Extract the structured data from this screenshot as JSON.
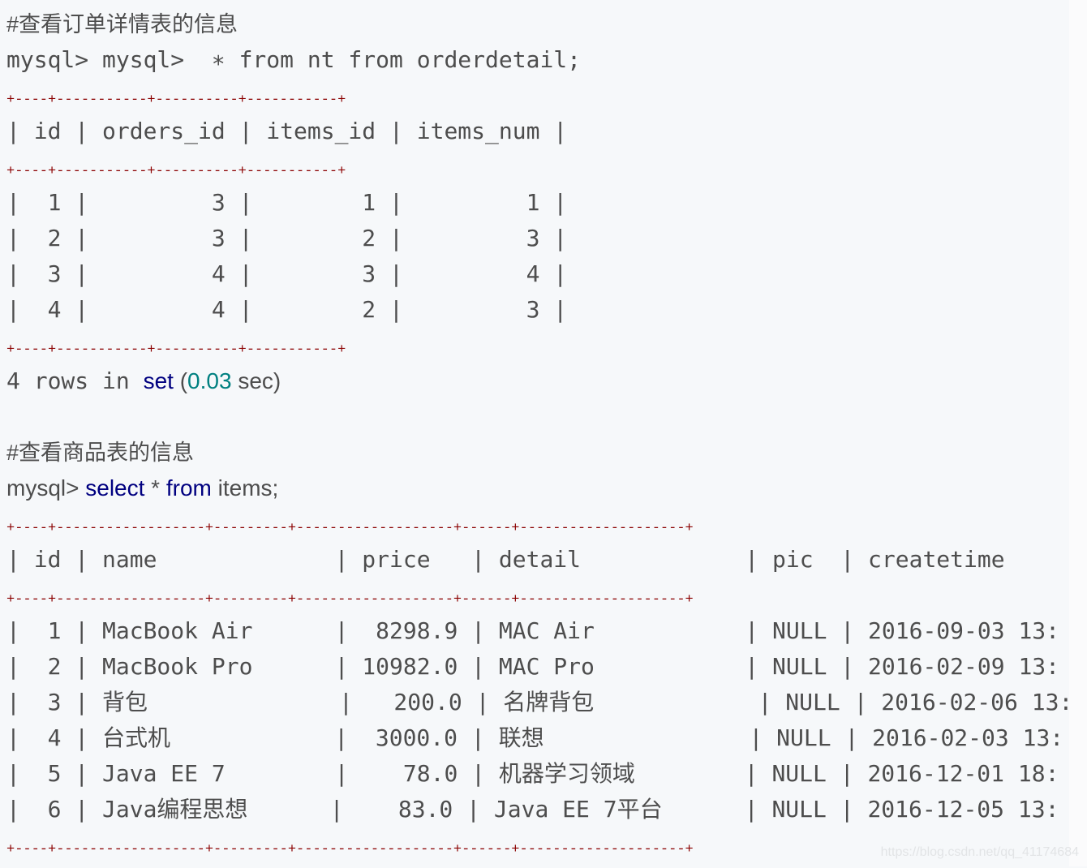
{
  "colors": {
    "background": "#f6f8fa",
    "text": "#4d4d4d",
    "keyword": "#000080",
    "number": "#008080",
    "table_border": "#8b0000"
  },
  "lines": [
    [
      {
        "t": "#查看订单详情表的信息",
        "c": "sans"
      }
    ],
    [
      {
        "t": "mysql> mysql>  ∗ from nt from orderdetail;",
        "c": ""
      }
    ],
    [
      {
        "t": "+----+-----------+----------+-----------+",
        "c": "border"
      }
    ],
    [
      {
        "t": "| id | orders_id | items_id | items_num |",
        "c": ""
      }
    ],
    [
      {
        "t": "+----+-----------+----------+-----------+",
        "c": "border"
      }
    ],
    [
      {
        "t": "|  1 |         3 |        1 |         1 |",
        "c": ""
      }
    ],
    [
      {
        "t": "|  2 |         3 |        2 |         3 |",
        "c": ""
      }
    ],
    [
      {
        "t": "|  3 |         4 |        3 |         4 |",
        "c": ""
      }
    ],
    [
      {
        "t": "|  4 |         4 |        2 |         3 |",
        "c": ""
      }
    ],
    [
      {
        "t": "+----+-----------+----------+-----------+",
        "c": "border"
      }
    ],
    [
      {
        "t": "4 rows in ",
        "c": ""
      },
      {
        "t": "set",
        "c": "kw"
      },
      {
        "t": " (",
        "c": "plain"
      },
      {
        "t": "0.03",
        "c": "num"
      },
      {
        "t": " sec)",
        "c": "plain"
      }
    ],
    [
      {
        "t": "",
        "c": ""
      }
    ],
    [
      {
        "t": "#查看商品表的信息",
        "c": "sans"
      }
    ],
    [
      {
        "t": "mysql> ",
        "c": "plain"
      },
      {
        "t": "select",
        "c": "kw"
      },
      {
        "t": " * ",
        "c": "plain"
      },
      {
        "t": "from",
        "c": "kw"
      },
      {
        "t": " items;",
        "c": "plain"
      }
    ],
    [
      {
        "t": "+----+------------------+---------+-------------------+------+--------------------+",
        "c": "border"
      }
    ],
    [
      {
        "t": "| id | name             | price   | detail            | pic  | createtime",
        "c": ""
      }
    ],
    [
      {
        "t": "+----+------------------+---------+-------------------+------+--------------------+",
        "c": "border"
      }
    ],
    [
      {
        "t": "|  1 | MacBook Air      |  8298.9 | MAC Air           | NULL | 2016-09-03 13:",
        "c": ""
      }
    ],
    [
      {
        "t": "|  2 | MacBook Pro      | 10982.0 | MAC Pro           | NULL | 2016-02-09 13:",
        "c": ""
      }
    ],
    [
      {
        "t": "|  3 | 背包              |   200.0 | 名牌背包            | NULL | 2016-02-06 13:",
        "c": ""
      }
    ],
    [
      {
        "t": "|  4 | 台式机            |  3000.0 | 联想               | NULL | 2016-02-03 13:",
        "c": ""
      }
    ],
    [
      {
        "t": "|  5 | Java EE 7        |    78.0 | 机器学习领域        | NULL | 2016-12-01 18:",
        "c": ""
      }
    ],
    [
      {
        "t": "|  6 | Java编程思想      |    83.0 | Java EE 7平台      | NULL | 2016-12-05 13:",
        "c": ""
      }
    ],
    [
      {
        "t": "+----+------------------+---------+-------------------+------+--------------------+",
        "c": "border"
      }
    ]
  ],
  "watermark": "https://blog.csdn.net/qq_41174684"
}
